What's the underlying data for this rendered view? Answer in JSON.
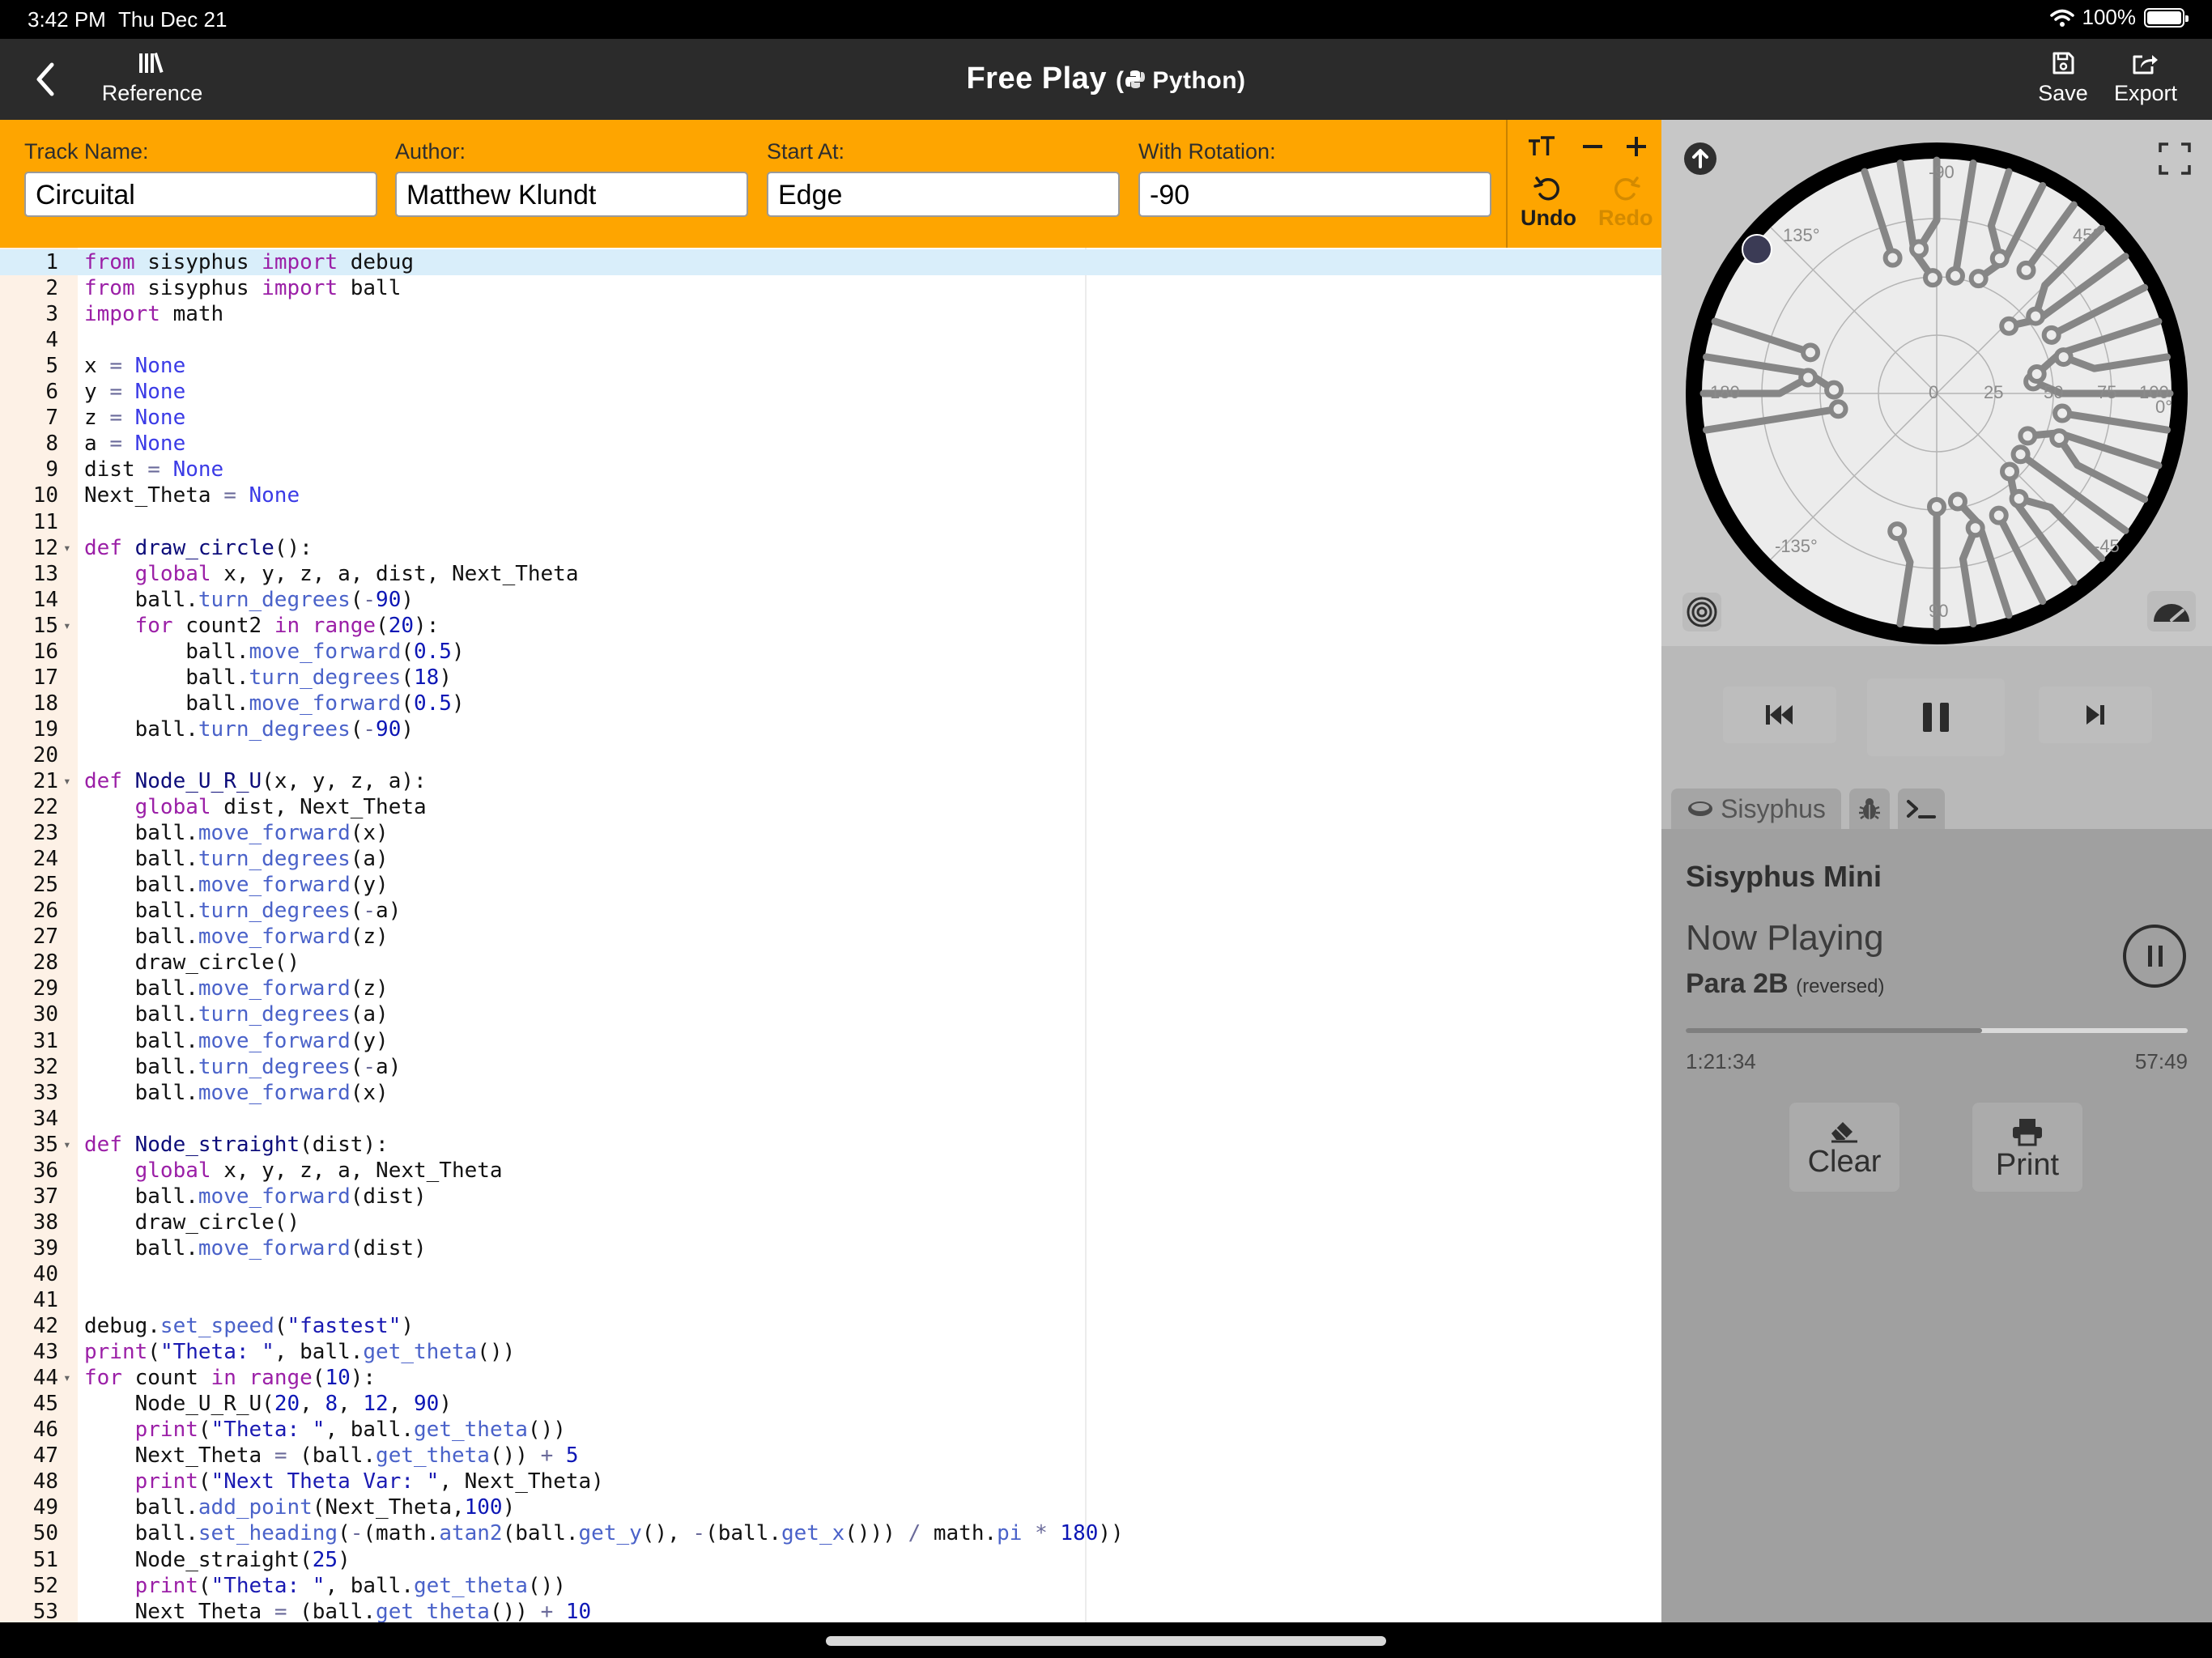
{
  "status": {
    "time": "3:42 PM",
    "date": "Thu Dec 21",
    "battery": "100%"
  },
  "nav": {
    "reference_label": "Reference",
    "title": "Free Play",
    "subtitle": "Python",
    "save_label": "Save",
    "export_label": "Export"
  },
  "track": {
    "track_name_label": "Track Name:",
    "track_name_value": "Circuital",
    "author_label": "Author:",
    "author_value": "Matthew Klundt",
    "start_label": "Start At:",
    "start_value": "Edge",
    "rotation_label": "With Rotation:",
    "rotation_value": "-90",
    "undo_label": "Undo",
    "redo_label": "Redo"
  },
  "code": {
    "active_line": 1,
    "folds": [
      12,
      15,
      21,
      35,
      44
    ],
    "lines": [
      "from sisyphus import debug",
      "from sisyphus import ball",
      "import math",
      "",
      "x = None",
      "y = None",
      "z = None",
      "a = None",
      "dist = None",
      "Next_Theta = None",
      "",
      "def draw_circle():",
      "    global x, y, z, a, dist, Next_Theta",
      "    ball.turn_degrees(-90)",
      "    for count2 in range(20):",
      "        ball.move_forward(0.5)",
      "        ball.turn_degrees(18)",
      "        ball.move_forward(0.5)",
      "    ball.turn_degrees(-90)",
      "",
      "def Node_U_R_U(x, y, z, a):",
      "    global dist, Next_Theta",
      "    ball.move_forward(x)",
      "    ball.turn_degrees(a)",
      "    ball.move_forward(y)",
      "    ball.turn_degrees(-a)",
      "    ball.move_forward(z)",
      "    draw_circle()",
      "    ball.move_forward(z)",
      "    ball.turn_degrees(a)",
      "    ball.move_forward(y)",
      "    ball.turn_degrees(-a)",
      "    ball.move_forward(x)",
      "",
      "def Node_straight(dist):",
      "    global x, y, z, a, Next_Theta",
      "    ball.move_forward(dist)",
      "    draw_circle()",
      "    ball.move_forward(dist)",
      "",
      "",
      "debug.set_speed(\"fastest\")",
      "print(\"Theta: \", ball.get_theta())",
      "for count in range(10):",
      "    Node_U_R_U(20, 8, 12, 90)",
      "    print(\"Theta: \", ball.get_theta())",
      "    Next_Theta = (ball.get_theta()) + 5",
      "    print(\"Next Theta Var: \", Next_Theta)",
      "    ball.add_point(Next_Theta,100)",
      "    ball.set_heading(-(math.atan2(ball.get_y(), -(ball.get_x())) / math.pi * 180))",
      "    Node_straight(25)",
      "    print(\"Theta: \", ball.get_theta())",
      "    Next_Theta = (ball.get_theta()) + 10"
    ]
  },
  "preview": {
    "polar_labels": [
      "-90",
      "135°",
      "45°",
      "180",
      "0",
      "25",
      "50",
      "75",
      "100",
      "0°",
      "-135°",
      "-45",
      "90"
    ]
  },
  "player": {
    "tabs": {
      "sisyphus": "Sisyphus"
    },
    "device": "Sisyphus Mini",
    "now_playing_label": "Now Playing",
    "track": "Para 2B",
    "track_note": "(reversed)",
    "progress": 0.59,
    "elapsed": "1:21:34",
    "remaining": "57:49",
    "clear_label": "Clear",
    "print_label": "Print"
  }
}
